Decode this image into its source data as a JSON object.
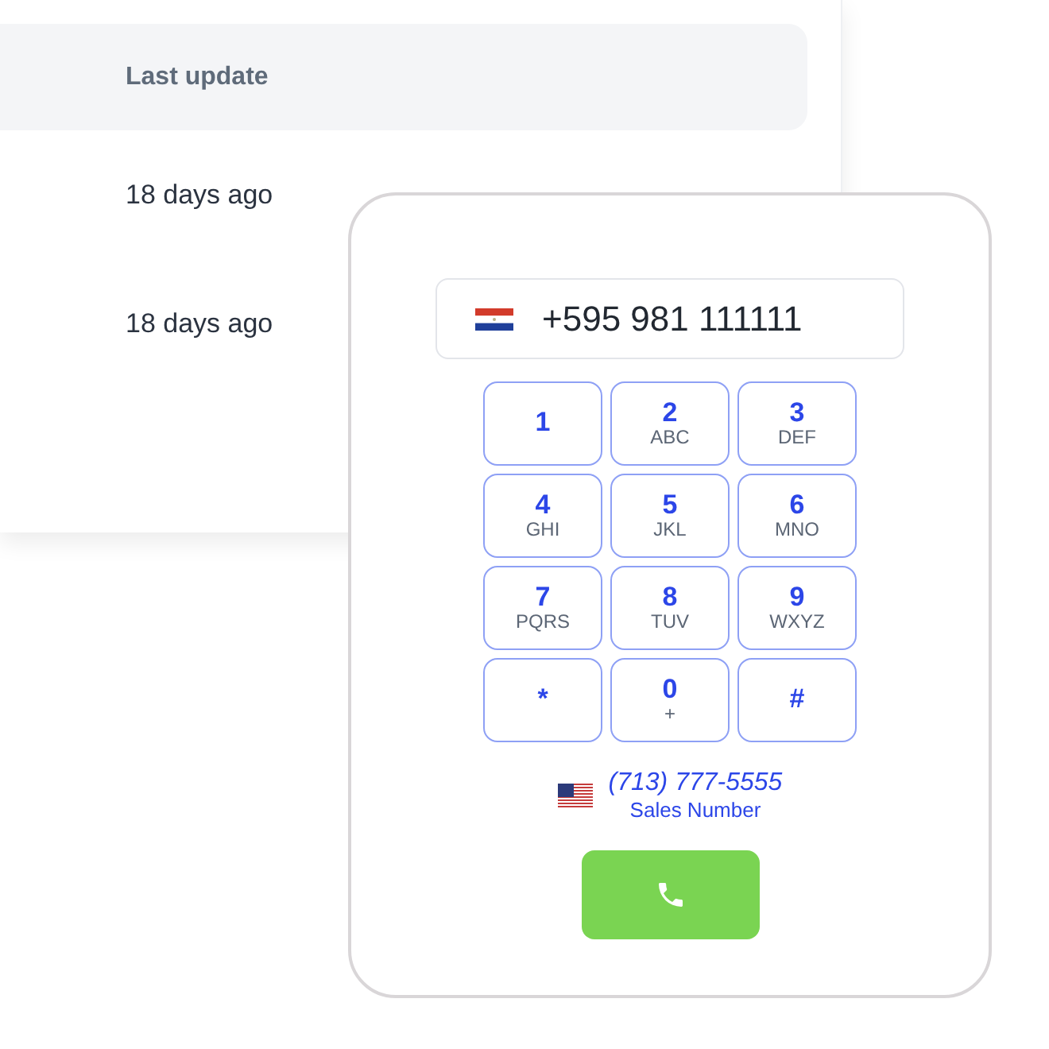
{
  "table": {
    "column_header": "Last update",
    "rows": [
      {
        "last_update": "18 days ago"
      },
      {
        "last_update": "18 days ago"
      }
    ]
  },
  "dialer": {
    "phone_number": "+595 981 111111",
    "keys": [
      {
        "digit": "1"
      },
      {
        "digit": "2",
        "letters": "ABC"
      },
      {
        "digit": "3",
        "letters": "DEF"
      },
      {
        "digit": "4",
        "letters": "GHI"
      },
      {
        "digit": "5",
        "letters": "JKL"
      },
      {
        "digit": "6",
        "letters": "MNO"
      },
      {
        "digit": "7",
        "letters": "PQRS"
      },
      {
        "digit": "8",
        "letters": "TUV"
      },
      {
        "digit": "9",
        "letters": "WXYZ"
      },
      {
        "digit": "*"
      },
      {
        "digit": "0",
        "letters": "+"
      },
      {
        "digit": "#"
      }
    ],
    "caller_id": {
      "number": "(713) 777-5555",
      "label": "Sales Number"
    }
  }
}
